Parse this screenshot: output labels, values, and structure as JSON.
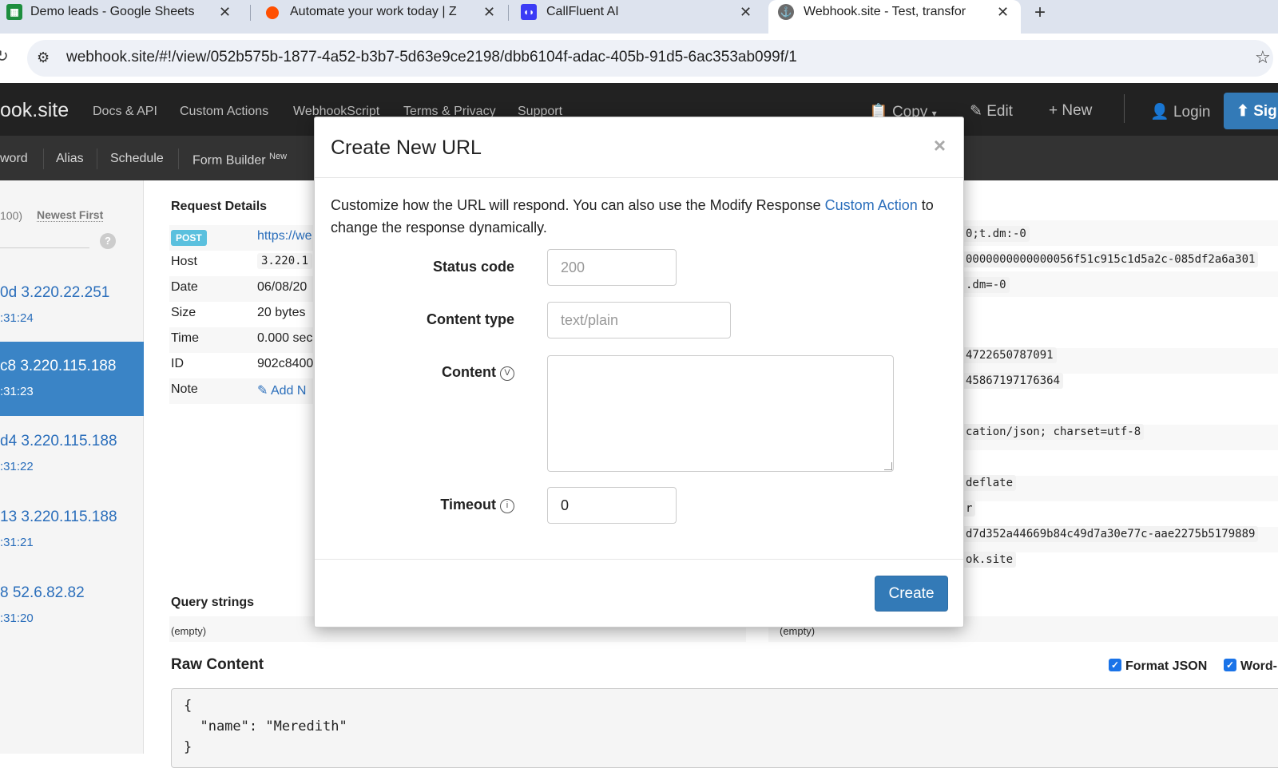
{
  "browser": {
    "tabs": [
      {
        "title": "Demo leads - Google Sheets",
        "icon": "sheets-icon"
      },
      {
        "title": "Automate your work today | Z",
        "icon": "zapier-icon"
      },
      {
        "title": "CallFluent AI",
        "icon": "callfluent-icon"
      },
      {
        "title": "Webhook.site - Test, transfor",
        "icon": "webhook-icon",
        "active": true
      }
    ],
    "url": "webhook.site/#!/view/052b575b-1877-4a52-b3b7-5d63e9ce2198/dbb6104f-adac-405b-91d5-6ac353ab099f/1"
  },
  "navbar": {
    "brand": "ook.site",
    "links": [
      "Docs & API",
      "Custom Actions",
      "WebhookScript",
      "Terms & Privacy",
      "Support"
    ],
    "copy_label": "Copy",
    "edit_label": "Edit",
    "new_label": "New",
    "login_label": "Login",
    "sign_label": "Sig"
  },
  "subnav": {
    "items": [
      "word",
      "Alias",
      "Schedule",
      "Form Builder"
    ],
    "form_builder_badge": "New"
  },
  "sidebar": {
    "count_label": "100)",
    "sort_label": "Newest First",
    "help": "?",
    "requests": [
      {
        "line1": "0d 3.220.22.251",
        "line2": ":31:24"
      },
      {
        "line1": "c8 3.220.115.188",
        "line2": ":31:23",
        "active": true
      },
      {
        "line1": "d4 3.220.115.188",
        "line2": ":31:22"
      },
      {
        "line1": "13 3.220.115.188",
        "line2": ":31:21"
      },
      {
        "line1": "8 52.6.82.82",
        "line2": ":31:20"
      }
    ]
  },
  "request_details": {
    "title": "Request Details",
    "method": "POST",
    "url_value": "https://we",
    "rows": [
      {
        "label": "Host",
        "value": "3.220.1"
      },
      {
        "label": "Date",
        "value": "06/08/20"
      },
      {
        "label": "Size",
        "value": "20 bytes"
      },
      {
        "label": "Time",
        "value": "0.000 sec"
      },
      {
        "label": "ID",
        "value": "902c8400"
      },
      {
        "label": "Note",
        "value": "Add N"
      }
    ]
  },
  "headers_values": [
    "0;t.dm:-0",
    "0000000000000056f51c915c1d5a2c-085df2a6a301",
    ".dm=-0",
    "4722650787091",
    "45867197176364",
    "cation/json; charset=utf-8",
    " deflate",
    "r",
    "d7d352a44669b84c49d7a30e77c-aae2275b5179889",
    "ok.site"
  ],
  "query_strings": {
    "title": "Query strings",
    "left_value": "(empty)",
    "right_value": "(empty)"
  },
  "raw_content": {
    "title": "Raw Content",
    "format_json_label": "Format JSON",
    "word_wrap_label": "Word-",
    "lines": [
      "{",
      "  \"name\": \"Meredith\"",
      "}"
    ]
  },
  "modal": {
    "title": "Create New URL",
    "close": "×",
    "description_prefix": "Customize how the URL will respond. You can also use the Modify Response ",
    "description_link": "Custom Action",
    "description_suffix": " to change the response dynamically.",
    "status_code_label": "Status code",
    "status_code_placeholder": "200",
    "content_type_label": "Content type",
    "content_type_placeholder": "text/plain",
    "content_label": "Content",
    "content_info": "V",
    "timeout_label": "Timeout",
    "timeout_info": "i",
    "timeout_value": "0",
    "create_label": "Create"
  },
  "colors": {
    "accent": "#337ab7",
    "navbar": "#222222",
    "subnav": "#333333",
    "active_request": "#3a84c6",
    "link": "#2a6ebb"
  }
}
